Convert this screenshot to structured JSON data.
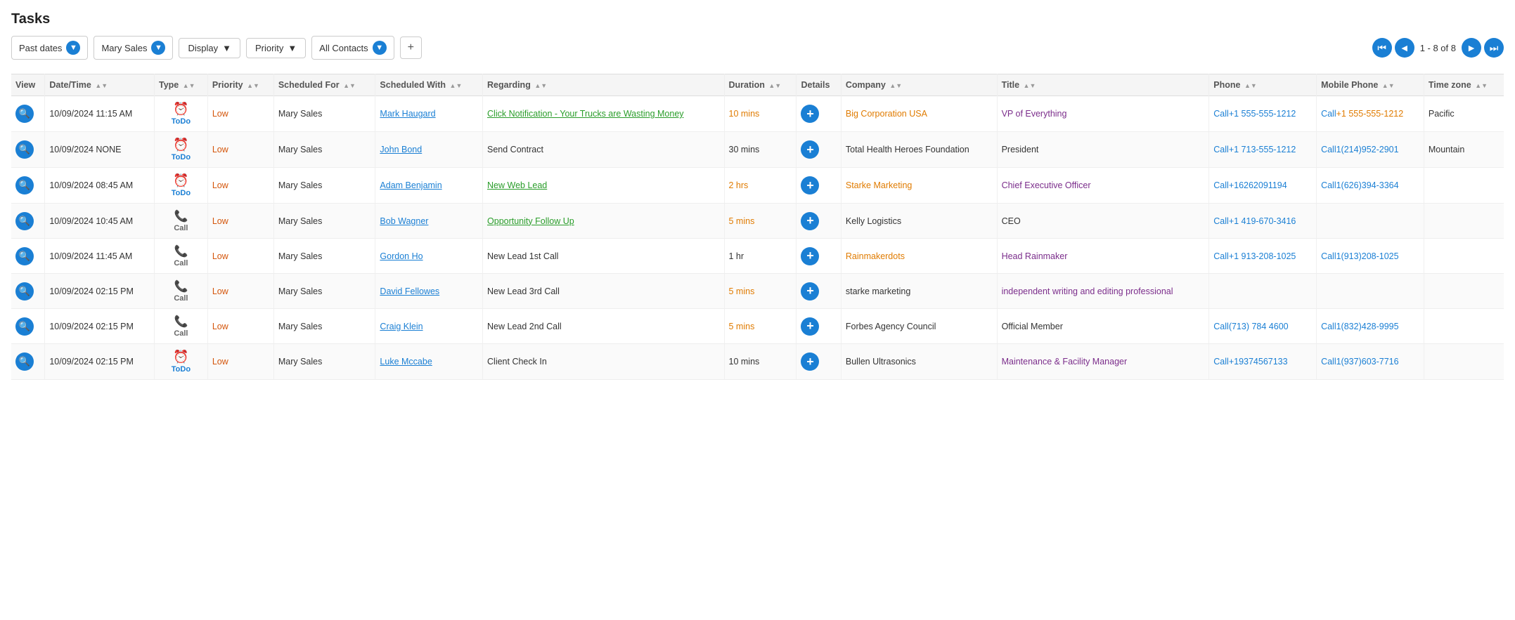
{
  "page": {
    "title": "Tasks"
  },
  "toolbar": {
    "filter1_label": "Past dates",
    "filter2_label": "Mary Sales",
    "filter3_label": "Display",
    "filter4_label": "Priority",
    "filter5_label": "All Contacts",
    "add_label": "+",
    "pagination_text": "1 - 8 of 8"
  },
  "table": {
    "columns": [
      {
        "key": "view",
        "label": "View"
      },
      {
        "key": "datetime",
        "label": "Date/Time",
        "sortable": true
      },
      {
        "key": "type",
        "label": "Type",
        "sortable": true
      },
      {
        "key": "priority",
        "label": "Priority",
        "sortable": true
      },
      {
        "key": "scheduled_for",
        "label": "Scheduled For",
        "sortable": true
      },
      {
        "key": "scheduled_with",
        "label": "Scheduled With",
        "sortable": true
      },
      {
        "key": "regarding",
        "label": "Regarding",
        "sortable": true
      },
      {
        "key": "duration",
        "label": "Duration",
        "sortable": true
      },
      {
        "key": "details",
        "label": "Details"
      },
      {
        "key": "company",
        "label": "Company",
        "sortable": true
      },
      {
        "key": "title",
        "label": "Title",
        "sortable": true
      },
      {
        "key": "phone",
        "label": "Phone",
        "sortable": true
      },
      {
        "key": "mobile_phone",
        "label": "Mobile Phone",
        "sortable": true
      },
      {
        "key": "timezone",
        "label": "Time zone",
        "sortable": true
      }
    ],
    "rows": [
      {
        "datetime": "10/09/2024 11:15 AM",
        "type": "ToDo",
        "type_kind": "todo",
        "priority": "Low",
        "scheduled_for": "Mary Sales",
        "scheduled_with": "Mark Haugard",
        "regarding": "Click Notification - Your Trucks are Wasting Money",
        "regarding_colored": true,
        "duration": "10 mins",
        "duration_colored": true,
        "company": "Big Corporation USA",
        "company_colored": true,
        "title": "VP of Everything",
        "title_colored": true,
        "phone": "Call+1 555-555-1212",
        "mobile_phone": "Call+1 555-555-1212",
        "mobile_colored": true,
        "timezone": "Pacific"
      },
      {
        "datetime": "10/09/2024 NONE",
        "type": "ToDo",
        "type_kind": "todo",
        "priority": "Low",
        "scheduled_for": "Mary Sales",
        "scheduled_with": "John Bond",
        "regarding": "Send Contract",
        "regarding_colored": false,
        "duration": "30 mins",
        "duration_colored": false,
        "company": "Total Health Heroes Foundation",
        "company_colored": false,
        "title": "President",
        "title_colored": false,
        "phone": "Call+1 713-555-1212",
        "mobile_phone": "Call1(214)952-2901",
        "mobile_colored": false,
        "timezone": "Mountain"
      },
      {
        "datetime": "10/09/2024 08:45 AM",
        "type": "ToDo",
        "type_kind": "todo",
        "priority": "Low",
        "scheduled_for": "Mary Sales",
        "scheduled_with": "Adam Benjamin",
        "regarding": "New Web Lead",
        "regarding_colored": true,
        "duration": "2 hrs",
        "duration_colored": true,
        "company": "Starke Marketing",
        "company_colored": true,
        "title": "Chief Executive Officer",
        "title_colored": true,
        "phone": "Call+16262091194",
        "mobile_phone": "Call1(626)394-3364",
        "mobile_colored": false,
        "timezone": ""
      },
      {
        "datetime": "10/09/2024 10:45 AM",
        "type": "Call",
        "type_kind": "call",
        "priority": "Low",
        "scheduled_for": "Mary Sales",
        "scheduled_with": "Bob Wagner",
        "regarding": "Opportunity Follow Up",
        "regarding_colored": true,
        "duration": "5 mins",
        "duration_colored": true,
        "company": "Kelly Logistics",
        "company_colored": false,
        "title": "CEO",
        "title_colored": false,
        "phone": "Call+1 419-670-3416",
        "mobile_phone": "",
        "mobile_colored": false,
        "timezone": ""
      },
      {
        "datetime": "10/09/2024 11:45 AM",
        "type": "Call",
        "type_kind": "call",
        "priority": "Low",
        "scheduled_for": "Mary Sales",
        "scheduled_with": "Gordon Ho",
        "regarding": "New Lead 1st Call",
        "regarding_colored": false,
        "duration": "1 hr",
        "duration_colored": false,
        "company": "Rainmakerdots",
        "company_colored": true,
        "title": "Head Rainmaker",
        "title_colored": true,
        "phone": "Call+1 913-208-1025",
        "mobile_phone": "Call1(913)208-1025",
        "mobile_colored": false,
        "timezone": ""
      },
      {
        "datetime": "10/09/2024 02:15 PM",
        "type": "Call",
        "type_kind": "call",
        "priority": "Low",
        "scheduled_for": "Mary Sales",
        "scheduled_with": "David Fellowes",
        "regarding": "New Lead 3rd Call",
        "regarding_colored": false,
        "duration": "5 mins",
        "duration_colored": true,
        "company": "starke marketing",
        "company_colored": false,
        "title": "independent writing and editing professional",
        "title_colored": true,
        "phone": "",
        "mobile_phone": "",
        "mobile_colored": false,
        "timezone": ""
      },
      {
        "datetime": "10/09/2024 02:15 PM",
        "type": "Call",
        "type_kind": "call",
        "priority": "Low",
        "scheduled_for": "Mary Sales",
        "scheduled_with": "Craig Klein",
        "regarding": "New Lead 2nd Call",
        "regarding_colored": false,
        "duration": "5 mins",
        "duration_colored": true,
        "company": "Forbes Agency Council",
        "company_colored": false,
        "title": "Official Member",
        "title_colored": false,
        "phone": "Call(713) 784 4600",
        "mobile_phone": "Call1(832)428-9995",
        "mobile_colored": false,
        "timezone": ""
      },
      {
        "datetime": "10/09/2024 02:15 PM",
        "type": "ToDo",
        "type_kind": "todo",
        "priority": "Low",
        "scheduled_for": "Mary Sales",
        "scheduled_with": "Luke Mccabe",
        "regarding": "Client Check In",
        "regarding_colored": false,
        "duration": "10 mins",
        "duration_colored": false,
        "company": "Bullen Ultrasonics",
        "company_colored": false,
        "title": "Maintenance & Facility Manager",
        "title_colored": true,
        "phone": "Call+19374567133",
        "mobile_phone": "Call1(937)603-7716",
        "mobile_colored": false,
        "timezone": ""
      }
    ]
  }
}
